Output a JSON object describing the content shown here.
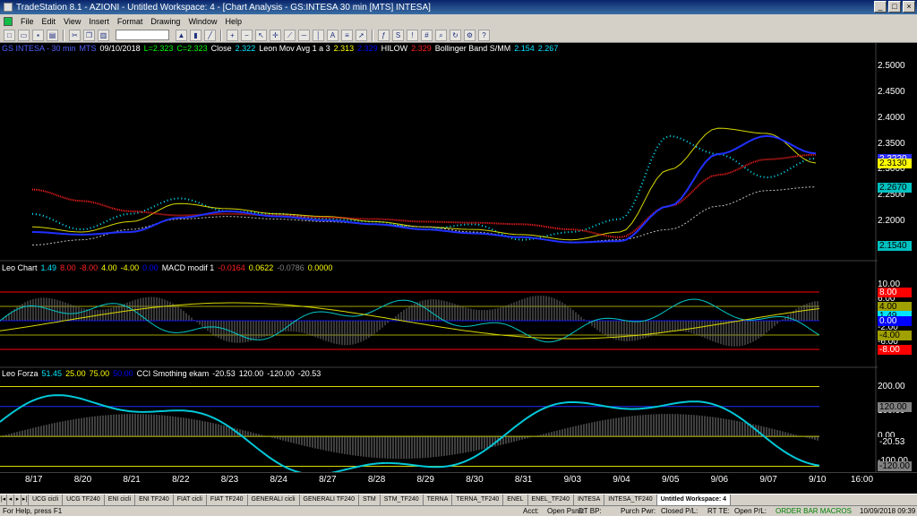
{
  "window": {
    "title": "TradeStation 8.1 - AZIONI - Untitled Workspace: 4 - [Chart Analysis - GS:INTESA  30 min  [MTS] INTESA]"
  },
  "menu": [
    "File",
    "Edit",
    "View",
    "Insert",
    "Format",
    "Drawing",
    "Window",
    "Help"
  ],
  "legend_price": [
    {
      "text": "GS INTESA - 30 min",
      "color": "#5060ff"
    },
    {
      "text": "MTS",
      "color": "#5060ff"
    },
    {
      "text": "09/10/2018",
      "color": "#ffffff"
    },
    {
      "text": "L=2.323",
      "color": "#00ff00"
    },
    {
      "text": "C=2.323",
      "color": "#00ff00"
    },
    {
      "text": "Close",
      "color": "#ffffff"
    },
    {
      "text": "2.322",
      "color": "#00e5ff"
    },
    {
      "text": "Leon Mov Avg 1 a 3",
      "color": "#ffffff"
    },
    {
      "text": "2.313",
      "color": "#ffff00"
    },
    {
      "text": "2.329",
      "color": "#0000ff"
    },
    {
      "text": "HILOW",
      "color": "#ffffff"
    },
    {
      "text": "2.329",
      "color": "#ff2020"
    },
    {
      "text": "Bollinger Band S/MM",
      "color": "#ffffff"
    },
    {
      "text": "2.154",
      "color": "#00e5ff"
    },
    {
      "text": "2.267",
      "color": "#00e5ff"
    }
  ],
  "legend_macd": [
    {
      "text": "Leo Chart",
      "color": "#ffffff"
    },
    {
      "text": "1.49",
      "color": "#00e5ff"
    },
    {
      "text": "8.00",
      "color": "#ff2020"
    },
    {
      "text": "-8.00",
      "color": "#ff2020"
    },
    {
      "text": "4.00",
      "color": "#ffff00"
    },
    {
      "text": "-4.00",
      "color": "#ffff00"
    },
    {
      "text": "0.00",
      "color": "#0000ff"
    },
    {
      "text": "MACD modif 1",
      "color": "#ffffff"
    },
    {
      "text": "-0.0164",
      "color": "#ff2020"
    },
    {
      "text": "0.0622",
      "color": "#ffff00"
    },
    {
      "text": "-0.0786",
      "color": "#808080"
    },
    {
      "text": "0.0000",
      "color": "#ffff00"
    }
  ],
  "legend_forza": [
    {
      "text": "Leo Forza",
      "color": "#ffffff"
    },
    {
      "text": "51.45",
      "color": "#00e5ff"
    },
    {
      "text": "25.00",
      "color": "#ffff00"
    },
    {
      "text": "75.00",
      "color": "#ffff00"
    },
    {
      "text": "50.00",
      "color": "#0000ff"
    },
    {
      "text": "CCI Smothing ekam",
      "color": "#ffffff"
    },
    {
      "text": "-20.53",
      "color": "#ffffff"
    },
    {
      "text": "120.00",
      "color": "#ffffff"
    },
    {
      "text": "-120.00",
      "color": "#ffffff"
    },
    {
      "text": "-20.53",
      "color": "#ffffff"
    }
  ],
  "price_scale": [
    "2.5000",
    "2.4500",
    "2.4000",
    "2.3500",
    "2.3000",
    "2.2500",
    "2.2000",
    "2.1500"
  ],
  "price_tags": [
    {
      "text": "2.3220",
      "bg": "#3030ff",
      "fg": "#ffffff"
    },
    {
      "text": "2.3130",
      "bg": "#ffff00",
      "fg": "#000000"
    },
    {
      "text": "2.2670",
      "bg": "#00c0c0",
      "fg": "#000000"
    },
    {
      "text": "2.1540",
      "bg": "#00c0c0",
      "fg": "#000000"
    }
  ],
  "macd_scale": [
    "10.00",
    "6.00",
    "2.00",
    "-2.00",
    "-6.00"
  ],
  "macd_tags": [
    {
      "text": "8.00",
      "bg": "#ff0000",
      "fg": "#ffffff"
    },
    {
      "text": "4.00",
      "bg": "#a0a000",
      "fg": "#000000"
    },
    {
      "text": "1.49",
      "bg": "#00e5ff",
      "fg": "#000000"
    },
    {
      "text": "0.00",
      "bg": "#0000ff",
      "fg": "#ffffff"
    },
    {
      "text": "-4.00",
      "bg": "#a0a000",
      "fg": "#000000"
    },
    {
      "text": "-8.00",
      "bg": "#ff0000",
      "fg": "#ffffff"
    }
  ],
  "cci_scale": [
    "200.00",
    "100.00",
    "0.00",
    "-100.00"
  ],
  "cci_tags": [
    {
      "text": "120.00",
      "bg": "#808080",
      "fg": "#000000"
    },
    {
      "text": "-20.53",
      "bg": "#000000",
      "fg": "#ffffff"
    },
    {
      "text": "-120.00",
      "bg": "#808080",
      "fg": "#000000"
    }
  ],
  "dates": [
    "8/17",
    "8/20",
    "8/21",
    "8/22",
    "8/23",
    "8/24",
    "8/27",
    "8/28",
    "8/29",
    "8/30",
    "8/31",
    "9/03",
    "9/04",
    "9/05",
    "9/06",
    "9/07",
    "9/10",
    "16:00"
  ],
  "tabs": [
    "UCG cicli",
    "UCG TF240",
    "ENI cicli",
    "ENI TF240",
    "FIAT cicli",
    "FIAT TF240",
    "GENERALI cicli",
    "GENERALI TF240",
    "STM",
    "STM_TF240",
    "TERNA",
    "TERNA_TF240",
    "ENEL",
    "ENEL_TF240",
    "INTESA",
    "INTESA_TF240",
    "Untitled Workspace: 4"
  ],
  "status": {
    "help": "For Help, press F1",
    "acct": "Acct:",
    "open_psns": "Open Psns:",
    "dt_bp": "DT BP:",
    "purch_pwr": "Purch Pwr:",
    "closed_pl": "Closed P/L:",
    "rt_te": "RT TE:",
    "open_pl": "Open P/L:",
    "mode": "ORDER BAR  MACROS",
    "datetime": "10/09/2018 09:39"
  },
  "chart_data": {
    "type": "line",
    "x": [
      "8/17",
      "8/20",
      "8/21",
      "8/22",
      "8/23",
      "8/24",
      "8/27",
      "8/28",
      "8/29",
      "8/30",
      "8/31",
      "9/03",
      "9/04",
      "9/05",
      "9/06",
      "9/07",
      "9/10"
    ],
    "series": [
      {
        "name": "Close",
        "values": [
          2.215,
          2.185,
          2.215,
          2.245,
          2.22,
          2.215,
          2.205,
          2.2,
          2.185,
          2.195,
          2.165,
          2.18,
          2.205,
          2.365,
          2.33,
          2.285,
          2.322
        ]
      },
      {
        "name": "Leon Mov Avg 1 a 3",
        "values": [
          2.19,
          2.18,
          2.2,
          2.235,
          2.225,
          2.215,
          2.21,
          2.2,
          2.19,
          2.185,
          2.175,
          2.165,
          2.18,
          2.3,
          2.38,
          2.37,
          2.313
        ]
      },
      {
        "name": "HILOW",
        "values": [
          2.262,
          2.24,
          2.22,
          2.212,
          2.215,
          2.212,
          2.208,
          2.205,
          2.2,
          2.198,
          2.195,
          2.185,
          2.17,
          2.23,
          2.29,
          2.32,
          2.329
        ]
      },
      {
        "name": "Bollinger Band S/MM",
        "values": [
          2.155,
          2.165,
          2.185,
          2.205,
          2.21,
          2.205,
          2.2,
          2.195,
          2.19,
          2.18,
          2.17,
          2.16,
          2.165,
          2.185,
          2.23,
          2.26,
          2.267
        ]
      }
    ],
    "ylim": [
      2.13,
      2.52
    ]
  }
}
